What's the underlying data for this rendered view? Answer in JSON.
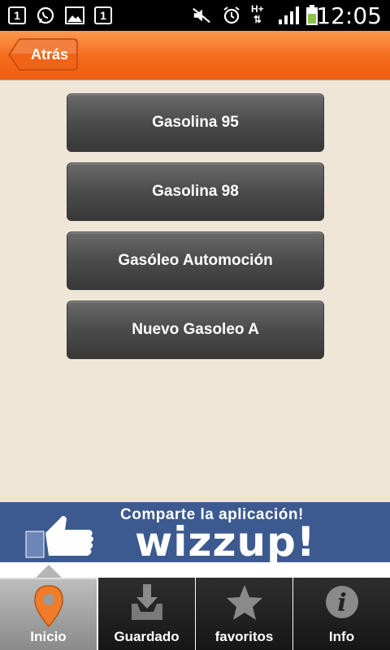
{
  "status_bar": {
    "notification_1": "1",
    "notification_2": "1",
    "network": "H+",
    "time": "12:05"
  },
  "header": {
    "back_label": "Atrás"
  },
  "fuel_options": [
    {
      "label": "Gasolina 95"
    },
    {
      "label": "Gasolina 98"
    },
    {
      "label": "Gasóleo Automoción"
    },
    {
      "label": "Nuevo Gasoleo A"
    }
  ],
  "banner": {
    "headline": "Comparte la aplicación!",
    "brand": "wizzup!"
  },
  "tabs": [
    {
      "label": "Inicio",
      "icon": "location-pin-icon",
      "active": true
    },
    {
      "label": "Guardado",
      "icon": "download-tray-icon",
      "active": false
    },
    {
      "label": "favoritos",
      "icon": "star-icon",
      "active": false
    },
    {
      "label": "Info",
      "icon": "info-icon",
      "active": false
    }
  ],
  "colors": {
    "header_orange": "#f46a1c",
    "background": "#efe6d8",
    "banner_blue": "#3c5a8f",
    "pin_orange": "#f07c2a"
  }
}
